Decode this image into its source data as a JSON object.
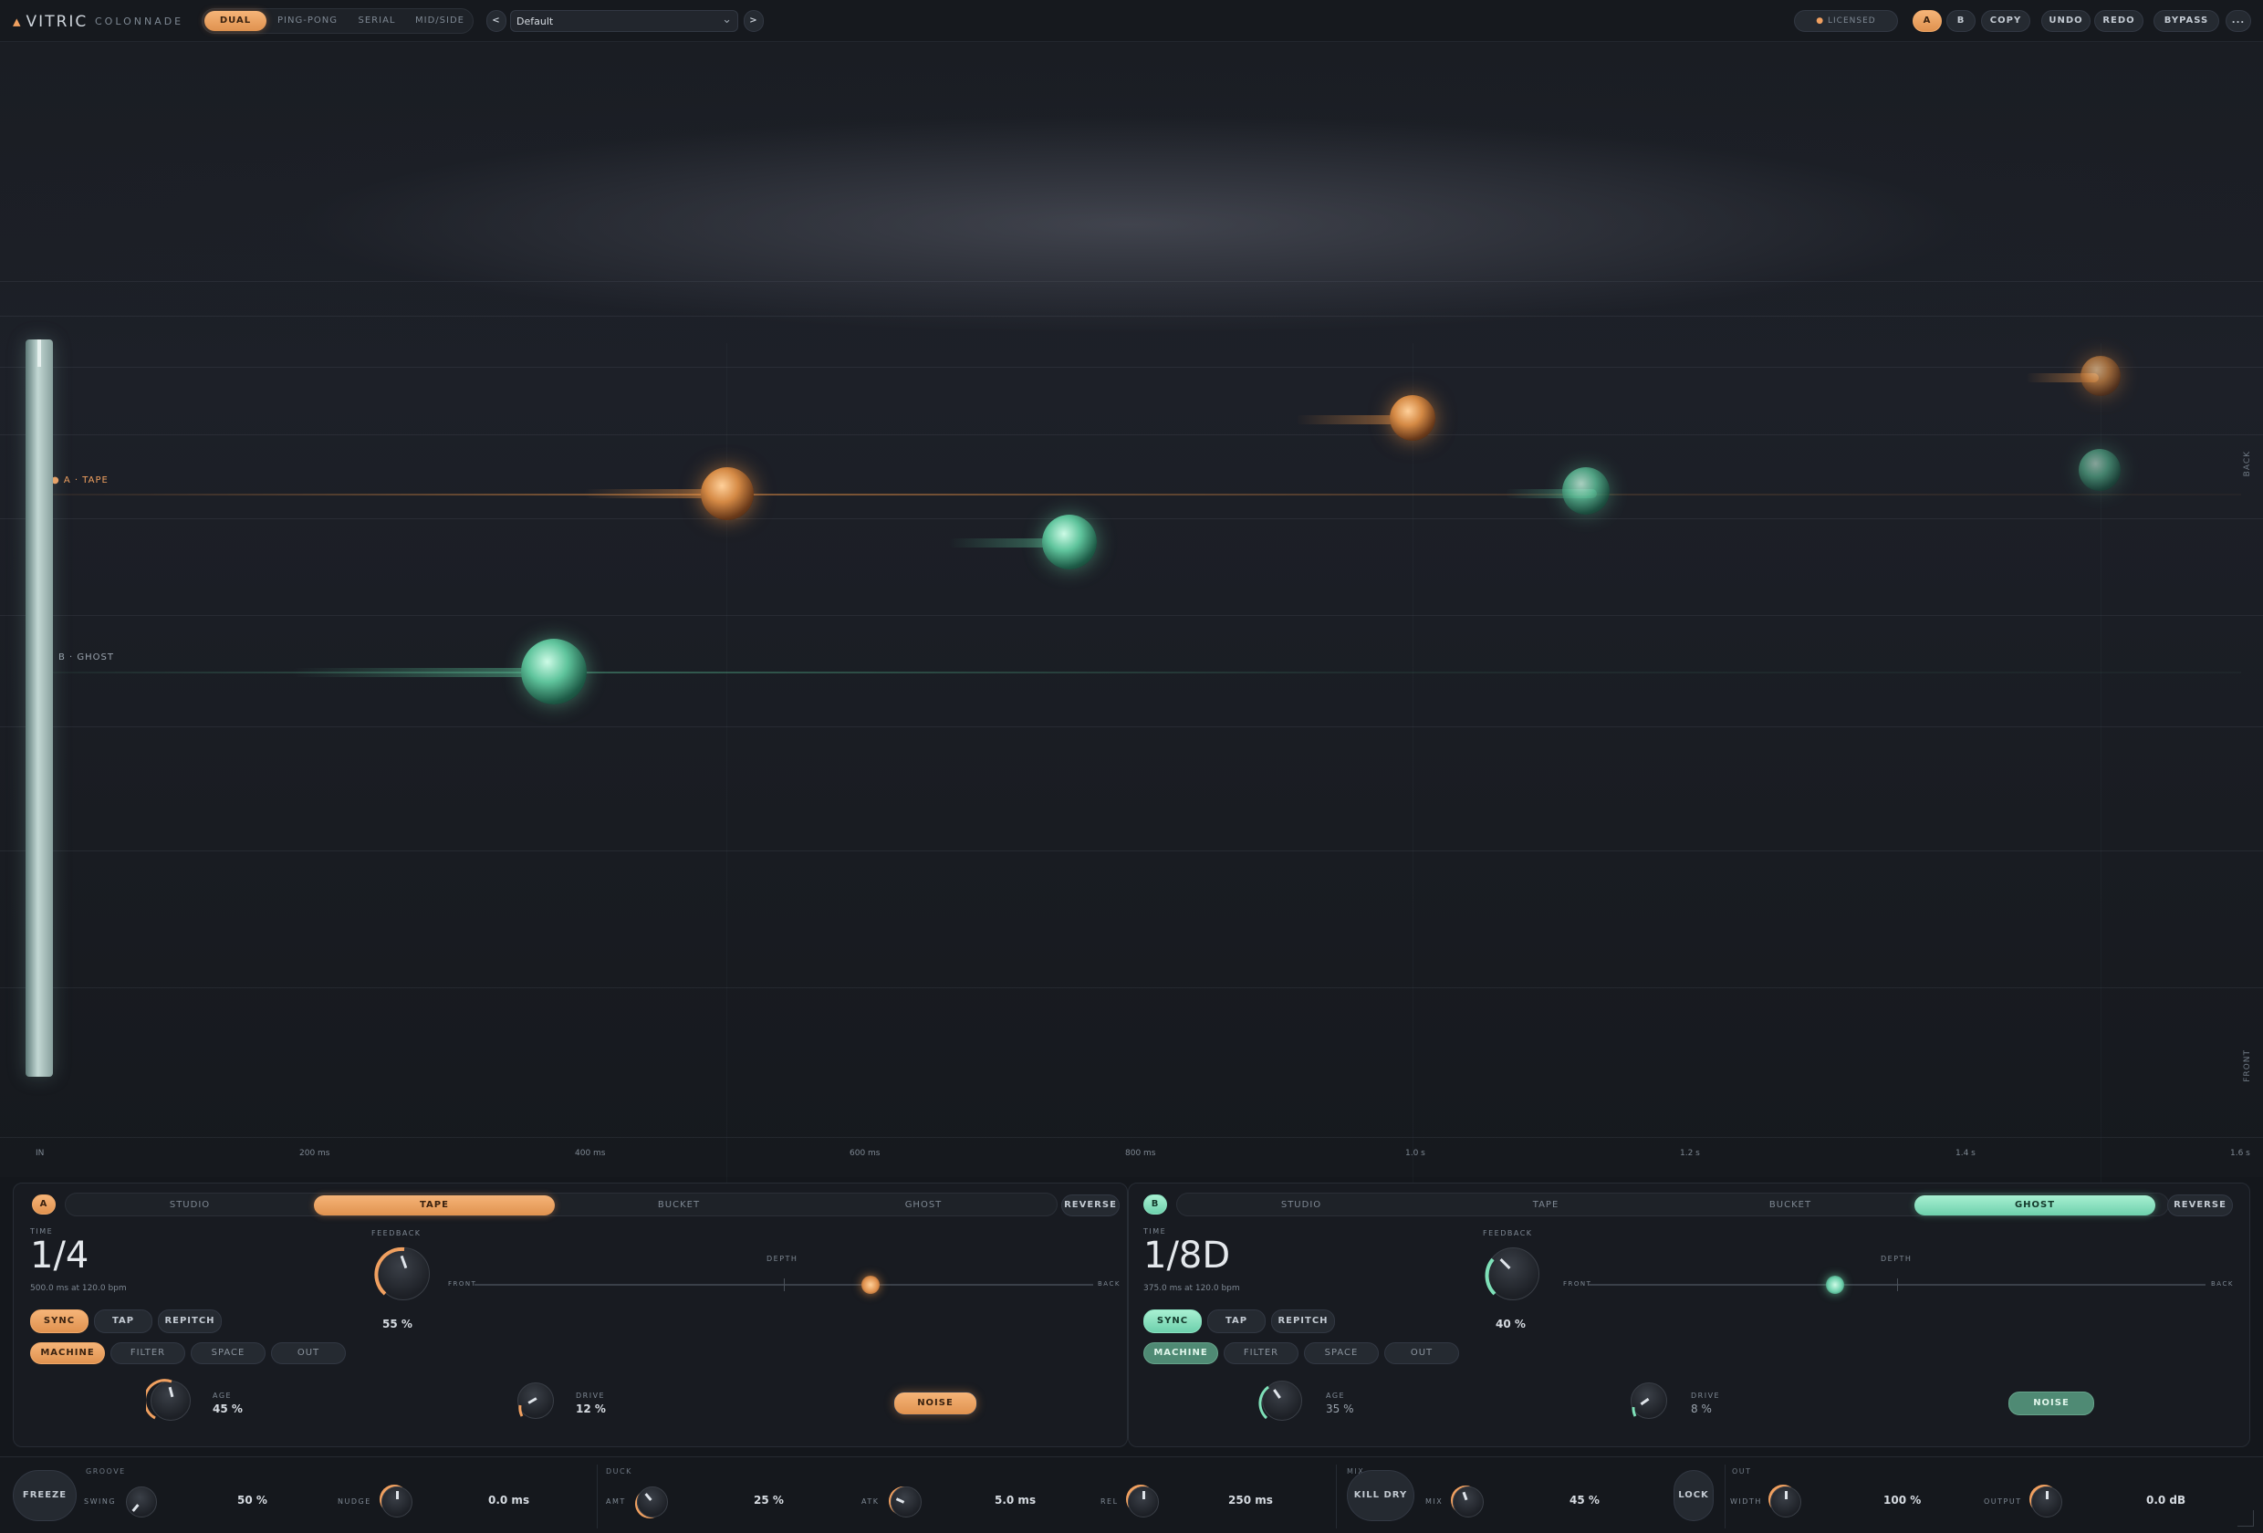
{
  "header": {
    "brand": "VITRIC",
    "product": "COLONNADE",
    "modes": [
      "DUAL",
      "PING-PONG",
      "SERIAL",
      "MID/SIDE"
    ],
    "active_mode": "DUAL",
    "preset_prev": "<",
    "preset_next": ">",
    "preset": "Default",
    "licensed": "LICENSED",
    "ab_a": "A",
    "ab_b": "B",
    "copy": "COPY",
    "undo": "UNDO",
    "redo": "REDO",
    "bypass": "BYPASS",
    "more": "..."
  },
  "stage": {
    "lane_a": "A · TAPE",
    "lane_b": "B · GHOST",
    "back": "BACK",
    "front": "FRONT",
    "axis": [
      "IN",
      "200 ms",
      "400 ms",
      "600 ms",
      "800 ms",
      "1.0 s",
      "1.2 s",
      "1.4 s",
      "1.6 s"
    ]
  },
  "line_a": {
    "badge": "A",
    "tabs": [
      "STUDIO",
      "TAPE",
      "BUCKET",
      "GHOST"
    ],
    "active": "TAPE",
    "reverse": "REVERSE",
    "time_label": "TIME",
    "time": "1/4",
    "time_sub": "500.0 ms at 120.0 bpm",
    "feedback_label": "FEEDBACK",
    "feedback": "55 %",
    "depth_label": "DEPTH",
    "front": "FRONT",
    "back": "BACK",
    "sync": "SYNC",
    "tap": "TAP",
    "repitch": "REPITCH",
    "subtabs": [
      "MACHINE",
      "FILTER",
      "SPACE",
      "OUT"
    ],
    "age_label": "AGE",
    "age": "45 %",
    "drive_label": "DRIVE",
    "drive": "12 %",
    "noise": "NOISE",
    "depth": 0.64
  },
  "line_b": {
    "badge": "B",
    "tabs": [
      "STUDIO",
      "TAPE",
      "BUCKET",
      "GHOST"
    ],
    "active": "GHOST",
    "reverse": "REVERSE",
    "time_label": "TIME",
    "time": "1/8D",
    "time_sub": "375.0 ms at 120.0 bpm",
    "feedback_label": "FEEDBACK",
    "feedback": "40 %",
    "depth_label": "DEPTH",
    "front": "FRONT",
    "back": "BACK",
    "sync": "SYNC",
    "tap": "TAP",
    "repitch": "REPITCH",
    "subtabs": [
      "MACHINE",
      "FILTER",
      "SPACE",
      "OUT"
    ],
    "age_label": "AGE",
    "age": "35 %",
    "drive_label": "DRIVE",
    "drive": "8 %",
    "noise": "NOISE",
    "depth": 0.4
  },
  "footer": {
    "freeze": "FREEZE",
    "groove": "GROOVE",
    "swing_label": "SWING",
    "swing": "50 %",
    "nudge_label": "NUDGE",
    "nudge": "0.0 ms",
    "duck": "DUCK",
    "amt_label": "AMT",
    "amt": "25 %",
    "atk_label": "ATK",
    "atk": "5.0 ms",
    "rel_label": "REL",
    "rel": "250 ms",
    "mix_sect": "MIX",
    "kill_dry": "KILL DRY",
    "mix_label": "MIX",
    "mix": "45 %",
    "lock": "LOCK",
    "out_sect": "OUT",
    "width_label": "WIDTH",
    "width": "100 %",
    "output_label": "OUTPUT",
    "output": "0.0 dB"
  },
  "colors": {
    "accent_a": "#f0a060",
    "accent_b": "#7ee0b8",
    "bg": "#14171c"
  }
}
